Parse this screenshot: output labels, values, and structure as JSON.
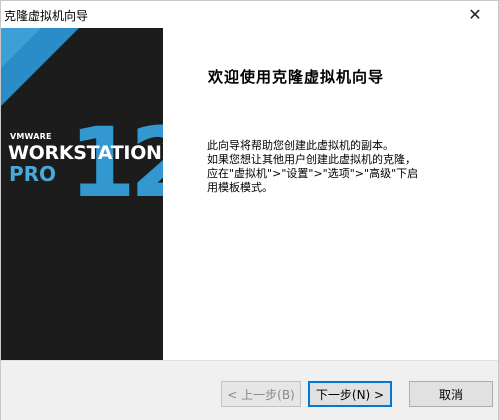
{
  "window": {
    "title": "克隆虚拟机向导",
    "close_glyph": "✕"
  },
  "banner": {
    "brand_small": "VMWARE",
    "brand_name": "WORKSTATION",
    "brand_sup": "™",
    "brand_edition": "PRO",
    "version": "12",
    "colors": {
      "background": "#1c1c1c",
      "accent_blue": "#2a8cc7",
      "accent_light": "#4aa8d8"
    }
  },
  "content": {
    "heading": "欢迎使用克隆虚拟机向导",
    "description_lines": [
      "此向导将帮助您创建此虚拟机的副本。",
      "如果您想让其他用户创建此虚拟机的克隆，",
      "应在\"虚拟机\">\"设置\">\"选项\">\"高级\"下启",
      "用模板模式。"
    ]
  },
  "buttons": {
    "back": "< 上一步(B)",
    "next": "下一步(N) >",
    "cancel": "取消"
  }
}
